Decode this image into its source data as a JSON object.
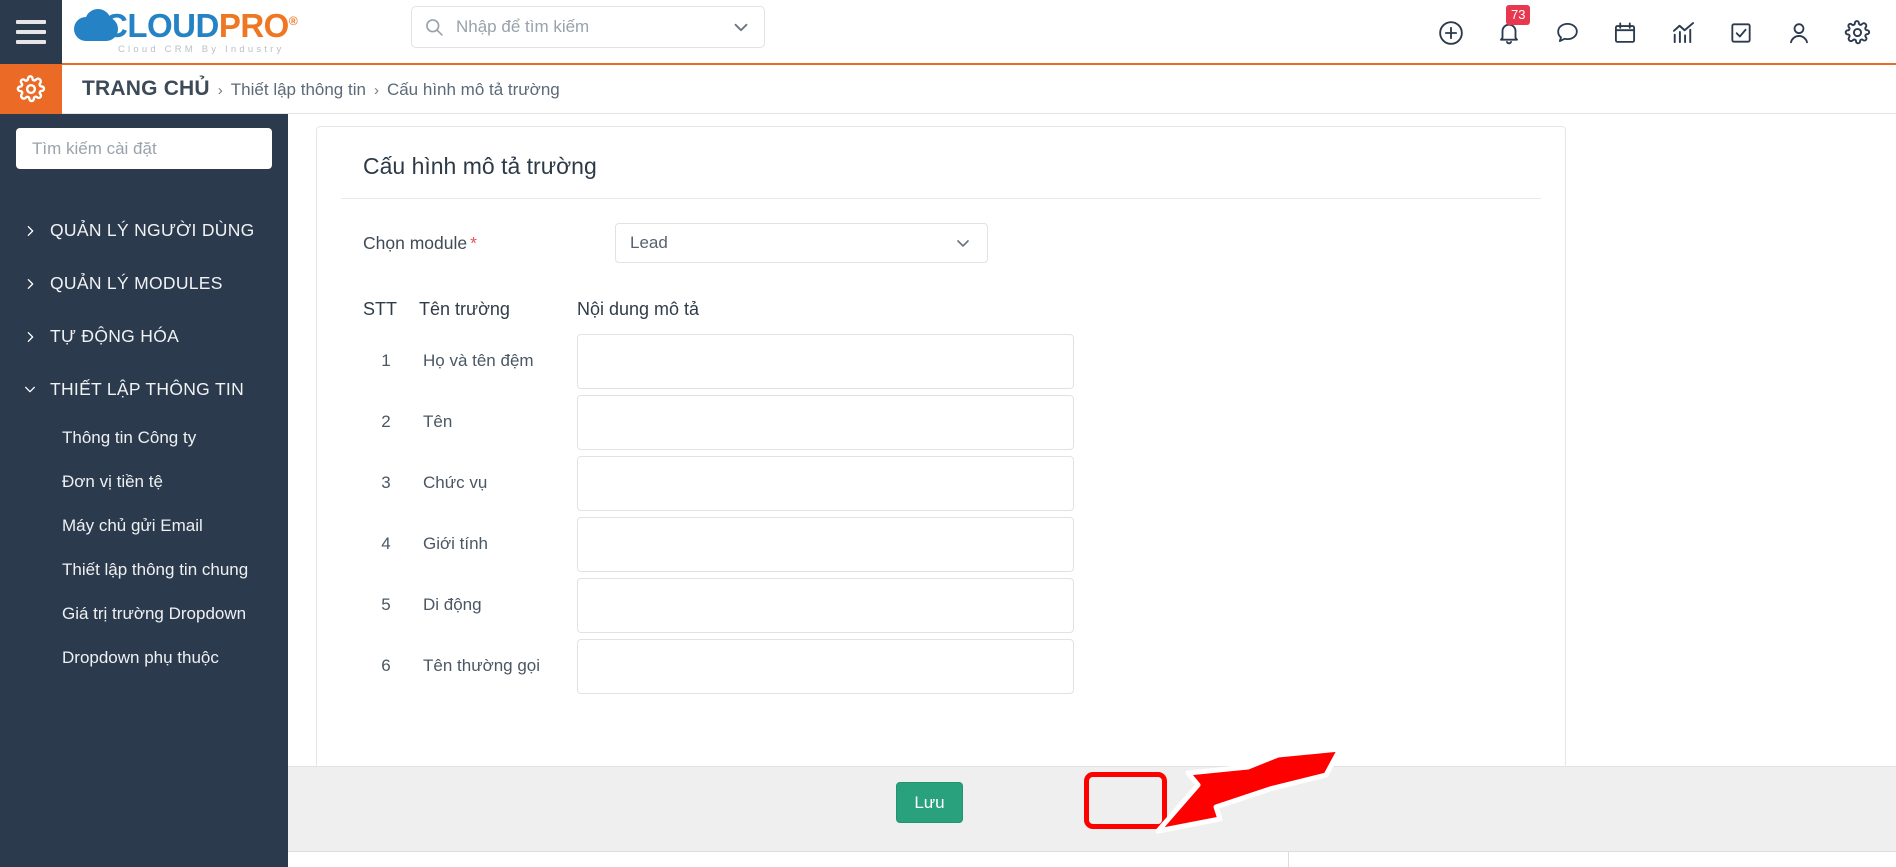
{
  "topbar": {
    "menu_icon": "hamburger-icon",
    "logo": {
      "cloud_part": "CLOUD",
      "pro_part": "PRO",
      "registered": "®",
      "tagline": "Cloud CRM By Industry"
    },
    "search": {
      "placeholder": "Nhập để tìm kiếm",
      "value": "",
      "icon": "search-icon",
      "caret_icon": "chevron-down-icon"
    },
    "icons": [
      {
        "name": "plus-circle-icon",
        "glyph": "plus"
      },
      {
        "name": "bell-icon",
        "glyph": "bell",
        "badge": "73"
      },
      {
        "name": "chat-bubble-icon",
        "glyph": "chat"
      },
      {
        "name": "calendar-icon",
        "glyph": "calendar"
      },
      {
        "name": "analytics-icon",
        "glyph": "chart"
      },
      {
        "name": "task-check-icon",
        "glyph": "check-square"
      },
      {
        "name": "user-icon",
        "glyph": "user"
      },
      {
        "name": "settings-gear-icon",
        "glyph": "gear"
      }
    ]
  },
  "breadcrumb": {
    "gear_icon": "settings-gear-icon",
    "home": "TRANG CHỦ",
    "separator": "›",
    "middle": "Thiết lập thông tin",
    "current": "Cấu hình mô tả trường"
  },
  "sidebar": {
    "search_placeholder": "Tìm kiếm cài đặt",
    "search_value": "",
    "groups": [
      {
        "label": "QUẢN LÝ NGƯỜI DÙNG",
        "expanded": false
      },
      {
        "label": "QUẢN LÝ MODULES",
        "expanded": false
      },
      {
        "label": "TỰ ĐỘNG HÓA",
        "expanded": false
      },
      {
        "label": "THIẾT LẬP THÔNG TIN",
        "expanded": true
      }
    ],
    "sub_items": [
      {
        "label": "Thông tin Công ty"
      },
      {
        "label": "Đơn vị tiền tệ"
      },
      {
        "label": "Máy chủ gửi Email"
      },
      {
        "label": "Thiết lập thông tin chung"
      },
      {
        "label": "Giá trị trường Dropdown"
      },
      {
        "label": "Dropdown phụ thuộc"
      }
    ]
  },
  "main": {
    "card_title": "Cấu hình mô tả trường",
    "module_label": "Chọn module",
    "required_mark": "*",
    "module_value": "Lead",
    "module_caret_icon": "chevron-down-icon",
    "table": {
      "headers": [
        "STT",
        "Tên trường",
        "Nội dung mô tả"
      ],
      "rows": [
        {
          "stt": "1",
          "name": "Họ và tên đệm",
          "desc": ""
        },
        {
          "stt": "2",
          "name": "Tên",
          "desc": ""
        },
        {
          "stt": "3",
          "name": "Chức vụ",
          "desc": ""
        },
        {
          "stt": "4",
          "name": "Giới tính",
          "desc": ""
        },
        {
          "stt": "5",
          "name": "Di động",
          "desc": ""
        },
        {
          "stt": "6",
          "name": "Tên thường gọi",
          "desc": ""
        }
      ]
    }
  },
  "footer": {
    "save_label": "Lưu"
  },
  "annotation": {
    "highlight_color": "#ff0000",
    "arrow_color": "#ff0000",
    "target": "save-button"
  },
  "colors": {
    "accent_orange": "#ea6a26",
    "sidebar_dark": "#2b3a4d",
    "logo_blue": "#2482c5",
    "logo_orange": "#ef7622",
    "save_green": "#28a17c",
    "badge_red": "#e8384f"
  }
}
